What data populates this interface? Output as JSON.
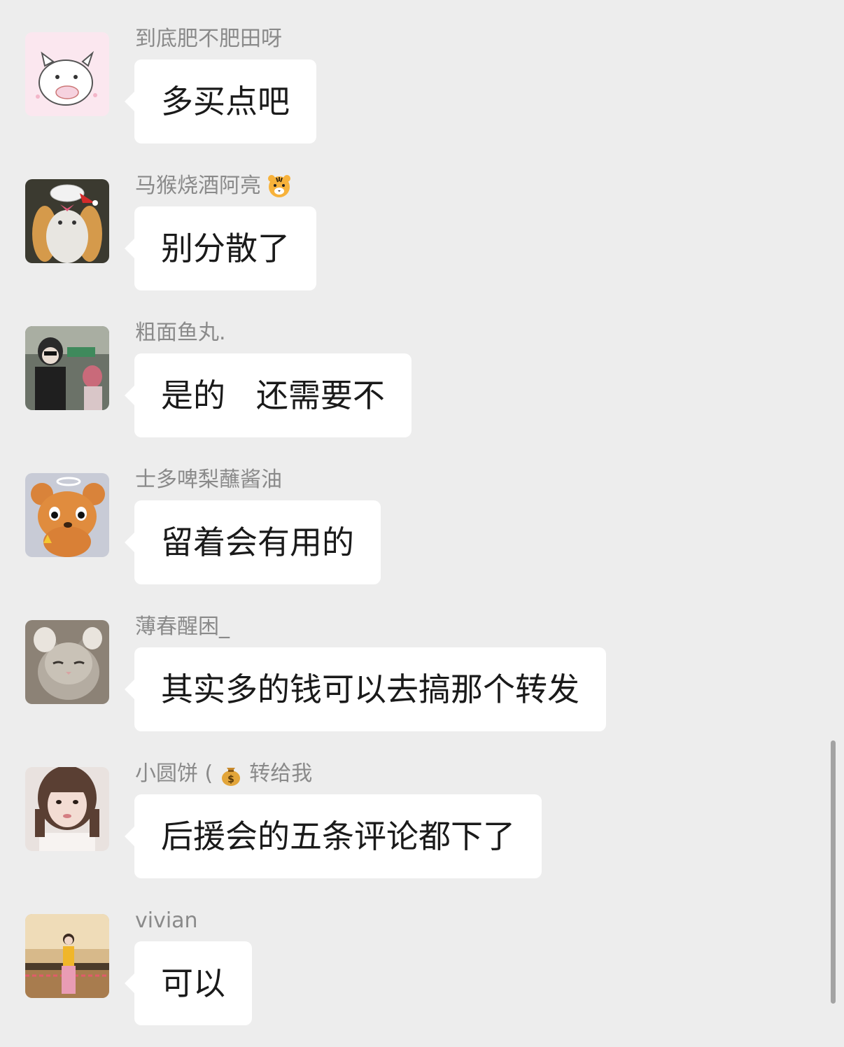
{
  "messages": [
    {
      "sender": "到底肥不肥田呀",
      "sender_emoji": null,
      "text": "多买点吧",
      "avatar_icon": "white-cat-sticker"
    },
    {
      "sender": "马猴烧酒阿亮",
      "sender_emoji": "tiger-face-emoji",
      "sender_suffix": "",
      "text": "别分散了",
      "avatar_icon": "cat-with-chef-hat"
    },
    {
      "sender": "粗面鱼丸.",
      "sender_emoji": null,
      "text": "是的   还需要不",
      "avatar_icon": "street-photo"
    },
    {
      "sender": "士多啤梨蘸酱油",
      "sender_emoji": null,
      "text": "留着会有用的",
      "avatar_icon": "plush-bear-with-halo"
    },
    {
      "sender": "薄春醒困_",
      "sender_emoji": null,
      "text": "其实多的钱可以去搞那个转发",
      "avatar_icon": "sleeping-kitten"
    },
    {
      "sender": "小圆饼 (",
      "sender_emoji": "money-bag-emoji",
      "sender_suffix": "转给我",
      "text": "后援会的五条评论都下了",
      "avatar_icon": "girl-portrait"
    },
    {
      "sender": "vivian",
      "sender_emoji": null,
      "text": "可以",
      "avatar_icon": "girl-in-mall"
    }
  ],
  "colors": {
    "background": "#ededed",
    "bubble": "#ffffff",
    "sender_text": "#8a8a8a",
    "message_text": "#1a1a1a",
    "scrollbar": "#a3a3a3"
  }
}
